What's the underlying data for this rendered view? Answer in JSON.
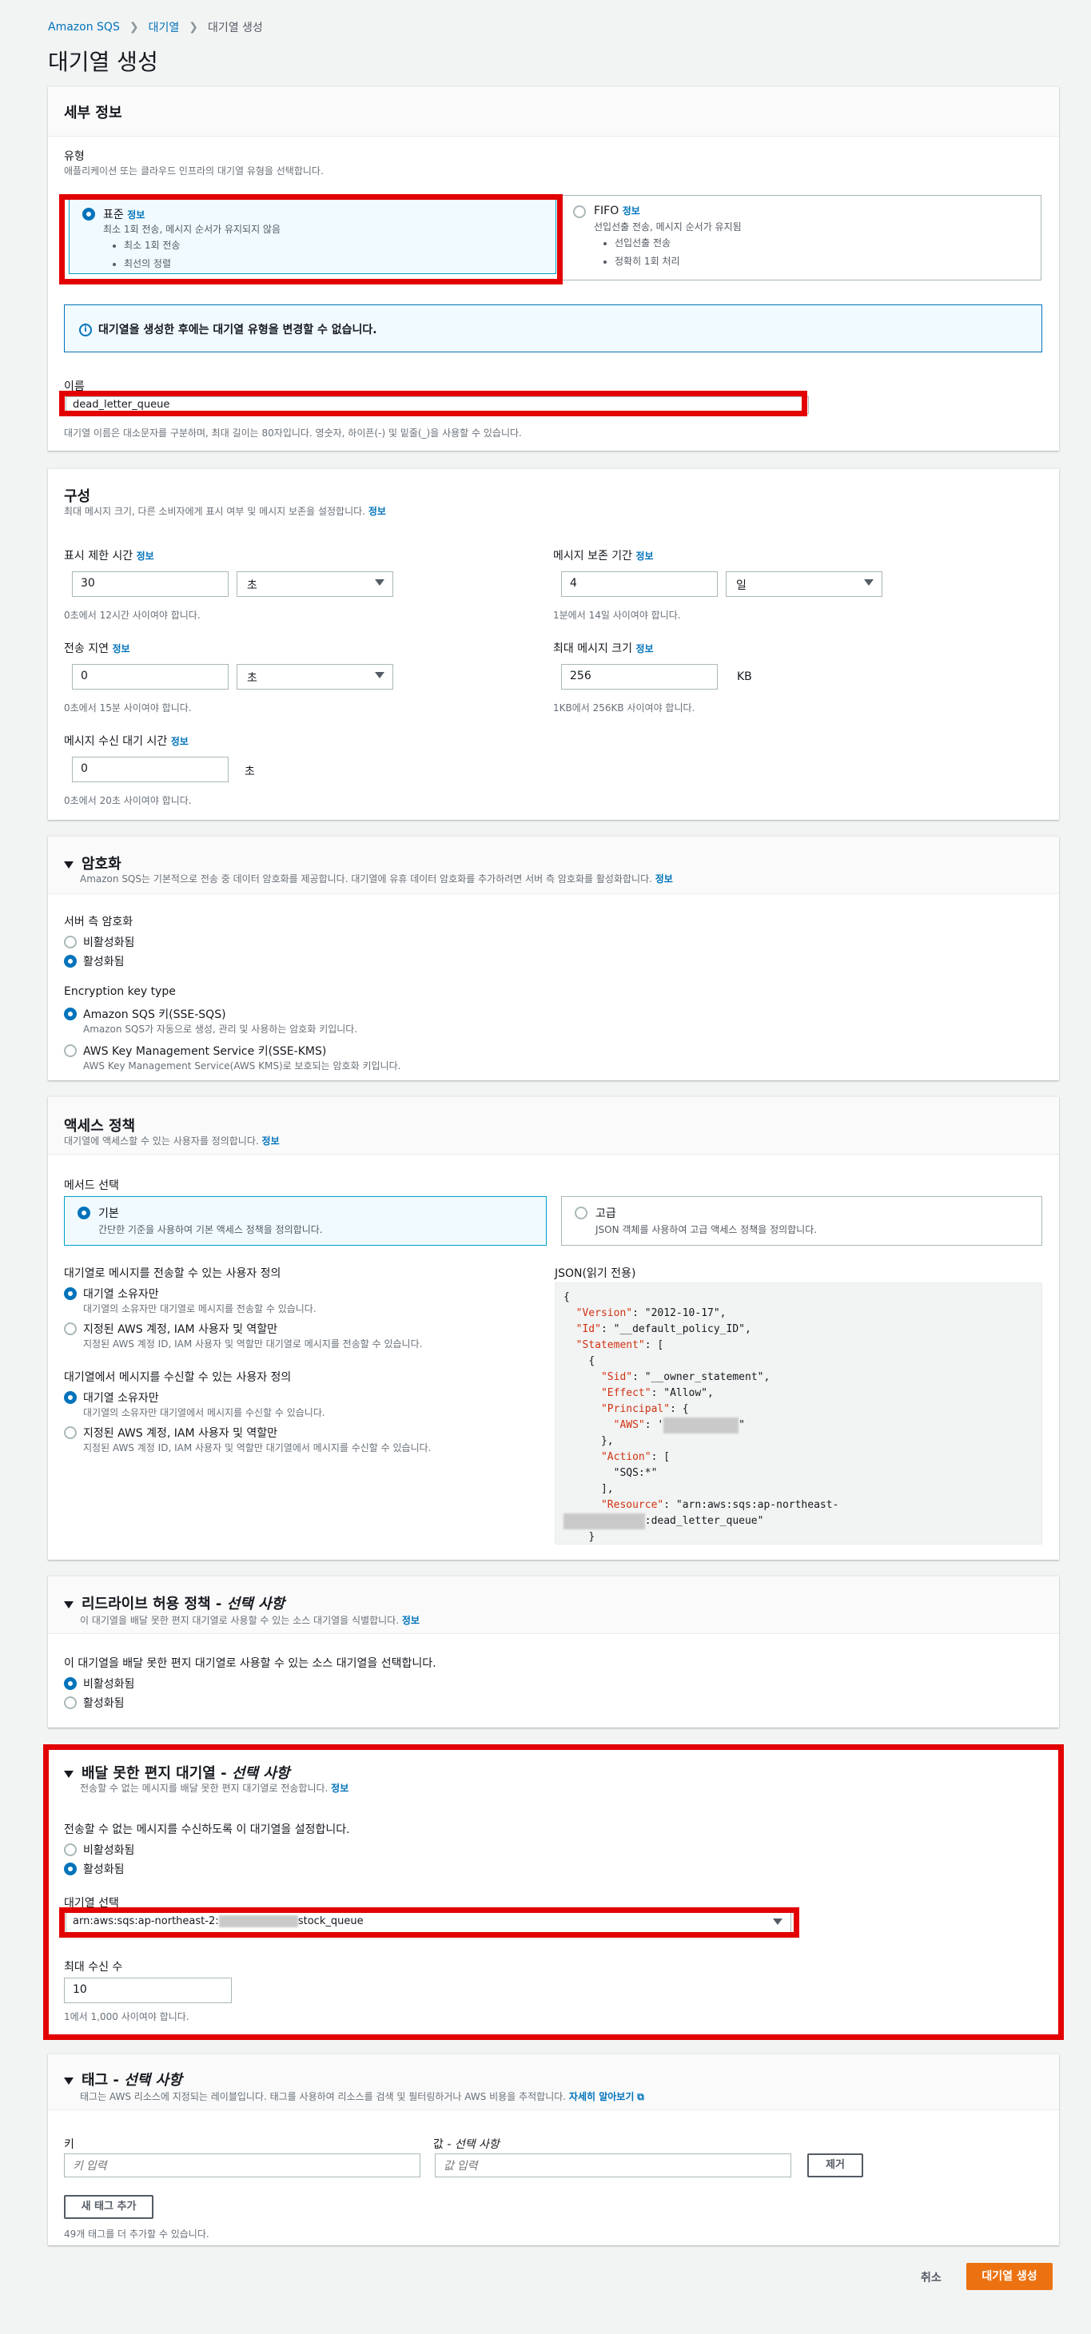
{
  "breadcrumb": {
    "items": [
      "Amazon SQS",
      "대기열",
      "대기열 생성"
    ]
  },
  "page_title": "대기열 생성",
  "details": {
    "title": "세부 정보",
    "type_label": "유형",
    "type_desc": "애플리케이션 또는 클라우드 인프라의 대기열 유형을 선택합니다.",
    "standard": {
      "title": "표준",
      "info": "정보",
      "desc": "최소 1회 전송, 메시지 순서가 유지되지 않음",
      "bullets": [
        "최소 1회 전송",
        "최선의 정렬"
      ]
    },
    "fifo": {
      "title": "FIFO",
      "info": "정보",
      "desc": "선입선출 전송, 메시지 순서가 유지됨",
      "bullets": [
        "선입선출 전송",
        "정확히 1회 처리"
      ]
    },
    "notice": "대기열을 생성한 후에는 대기열 유형을 변경할 수 없습니다.",
    "name_label": "이름",
    "name_value": "dead_letter_queue",
    "name_hint": "대기열 이름은 대소문자를 구분하며, 최대 길이는 80자입니다. 영숫자, 하이픈(-) 및 밑줄(_)을 사용할 수 있습니다."
  },
  "config": {
    "title": "구성",
    "desc": "최대 메시지 크기, 다른 소비자에게 표시 여부 및 메시지 보존을 설정합니다.",
    "info": "정보",
    "visibility": {
      "label": "표시 제한 시간",
      "info": "정보",
      "value": "30",
      "unit": "초",
      "hint": "0초에서 12시간 사이여야 합니다."
    },
    "retention": {
      "label": "메시지 보존 기간",
      "info": "정보",
      "value": "4",
      "unit": "일",
      "hint": "1분에서 14일 사이여야 합니다."
    },
    "delay": {
      "label": "전송 지연",
      "info": "정보",
      "value": "0",
      "unit": "초",
      "hint": "0초에서 15분 사이여야 합니다."
    },
    "max_size": {
      "label": "최대 메시지 크기",
      "info": "정보",
      "value": "256",
      "unit": "KB",
      "hint": "1KB에서 256KB 사이여야 합니다."
    },
    "wait": {
      "label": "메시지 수신 대기 시간",
      "info": "정보",
      "value": "0",
      "unit": "초",
      "hint": "0초에서 20초 사이여야 합니다."
    }
  },
  "encryption": {
    "title": "암호화",
    "desc": "Amazon SQS는 기본적으로 전송 중 데이터 암호화를 제공합니다. 대기열에 유휴 데이터 암호화를 추가하려면 서버 측 암호화를 활성화합니다.",
    "info": "정보",
    "sse_label": "서버 측 암호화",
    "opt_off": "비활성화됨",
    "opt_on": "활성화됨",
    "key_type_label": "Encryption key type",
    "key_sqs": {
      "title": "Amazon SQS 키(SSE-SQS)",
      "desc": "Amazon SQS가 자동으로 생성, 관리 및 사용하는 암호화 키입니다."
    },
    "key_kms": {
      "title": "AWS Key Management Service 키(SSE-KMS)",
      "desc": "AWS Key Management Service(AWS KMS)로 보호되는 암호화 키입니다."
    }
  },
  "access": {
    "title": "액세스 정책",
    "desc": "대기열에 액세스할 수 있는 사용자를 정의합니다.",
    "info": "정보",
    "method_label": "메서드 선택",
    "basic": {
      "title": "기본",
      "desc": "간단한 기준을 사용하여 기본 액세스 정책을 정의합니다."
    },
    "advanced": {
      "title": "고급",
      "desc": "JSON 객체를 사용하여 고급 액세스 정책을 정의합니다."
    },
    "send_label": "대기열로 메시지를 전송할 수 있는 사용자 정의",
    "send_owner": {
      "title": "대기열 소유자만",
      "desc": "대기열의 소유자만 대기열로 메시지를 전송할 수 있습니다."
    },
    "send_specified": {
      "title": "지정된 AWS 계정, IAM 사용자 및 역할만",
      "desc": "지정된 AWS 계정 ID, IAM 사용자 및 역할만 대기열로 메시지를 전송할 수 있습니다."
    },
    "recv_label": "대기열에서 메시지를 수신할 수 있는 사용자 정의",
    "recv_owner": {
      "title": "대기열 소유자만",
      "desc": "대기열의 소유자만 대기열에서 메시지를 수신할 수 있습니다."
    },
    "recv_specified": {
      "title": "지정된 AWS 계정, IAM 사용자 및 역할만",
      "desc": "지정된 AWS 계정 ID, IAM 사용자 및 역할만 대기열에서 메시지를 수신할 수 있습니다."
    },
    "json_label": "JSON(읽기 전용)",
    "json_lines": {
      "l1": "{",
      "l2k": "\"Version\"",
      "l2v": ": \"2012-10-17\",",
      "l3k": "\"Id\"",
      "l3v": ": \"__default_policy_ID\",",
      "l4k": "\"Statement\"",
      "l4v": ": [",
      "l5": "{",
      "l6k": "\"Sid\"",
      "l6v": ": \"__owner_statement\",",
      "l7k": "\"Effect\"",
      "l7v": ": \"Allow\",",
      "l8k": "\"Principal\"",
      "l8v": ": {",
      "l9k": "\"AWS\"",
      "l9v": ": '",
      "l9end": "\"",
      "l10": "},",
      "l11k": "\"Action\"",
      "l11v": ": [",
      "l12": "\"SQS:*\"",
      "l13": "],",
      "l14k": "\"Resource\"",
      "l14v": ": \"arn:aws:sqs:ap-northeast-",
      "l15v": ":dead_letter_queue\"",
      "l16": "}"
    }
  },
  "redrive_allow": {
    "title": "리드라이브 허용 정책 - ",
    "title_opt": "선택 사항",
    "desc": "이 대기열을 배달 못한 편지 대기열로 사용할 수 있는 소스 대기열을 식별합니다.",
    "info": "정보",
    "question": "이 대기열을 배달 못한 편지 대기열로 사용할 수 있는 소스 대기열을 선택합니다.",
    "opt_off": "비활성화됨",
    "opt_on": "활성화됨"
  },
  "dlq": {
    "title": "배달 못한 편지 대기열 - ",
    "title_opt": "선택 사항",
    "desc": "전송할 수 없는 메시지를 배달 못한 편지 대기열로 전송합니다.",
    "info": "정보",
    "question": "전송할 수 없는 메시지를 수신하도록 이 대기열을 설정합니다.",
    "opt_off": "비활성화됨",
    "opt_on": "활성화됨",
    "queue_label": "대기열 선택",
    "queue_prefix": "arn:aws:sqs:ap-northeast-2:",
    "queue_suffix": "stock_queue",
    "max_receives_label": "최대 수신 수",
    "max_receives_value": "10",
    "max_receives_hint": "1에서 1,000 사이여야 합니다."
  },
  "tags": {
    "title": "태그 - ",
    "title_opt": "선택 사항",
    "desc": "태그는 AWS 리소스에 지정되는 레이블입니다. 태그를 사용하여 리소스를 검색 및 필터링하거나 AWS 비용을 추적합니다.",
    "learn_more": "자세히 알아보기",
    "key_label": "키",
    "key_placeholder": "키 입력",
    "value_label": "값 - ",
    "value_label_opt": "선택 사항",
    "value_placeholder": "값 입력",
    "remove_button": "제거",
    "add_button": "새 태그 추가",
    "hint": "49개 태그를 더 추가할 수 있습니다."
  },
  "footer": {
    "cancel": "취소",
    "create": "대기열 생성"
  },
  "colors": {
    "accent": "#0073bb",
    "primary_button": "#ec7211",
    "highlight": "#e20000"
  }
}
